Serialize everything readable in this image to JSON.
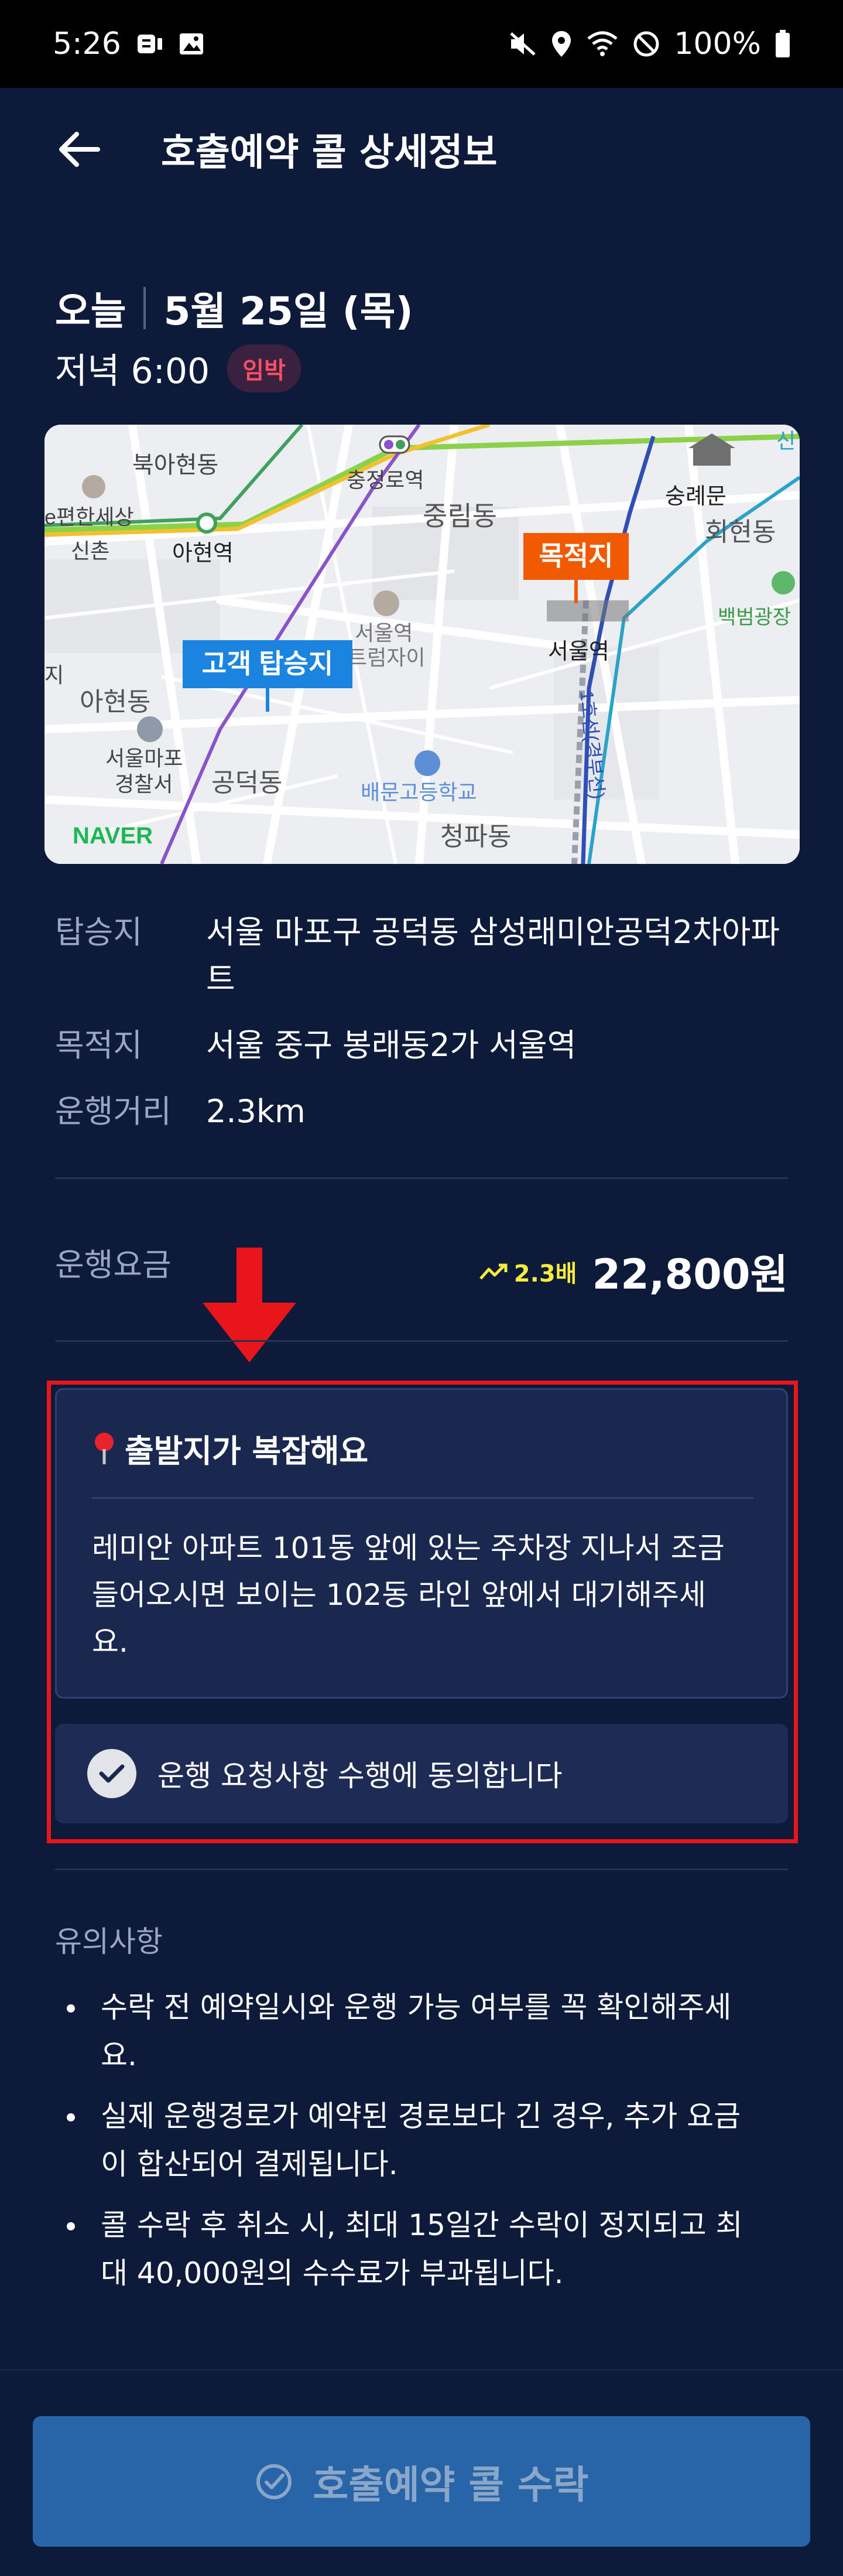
{
  "status_bar": {
    "time": "5:26",
    "battery": "100%"
  },
  "header": {
    "title": "호출예약 콜 상세정보"
  },
  "schedule": {
    "day": "오늘",
    "date": "5월 25일 (목)",
    "time": "저녁 6:00",
    "badge": "임박"
  },
  "map": {
    "labels": {
      "chungjeongno": "충정로역",
      "bukahyeon": "북아현동",
      "pyeonhan": "e편한세상",
      "sinchon": "신촌",
      "ahyeon_station": "아현역",
      "jungnim": "중림동",
      "sungnyemun": "숭례문",
      "hoehyeon": "회현동",
      "baekbeom": "백범광장",
      "seoul_station_tower": "서울역",
      "trade": "트럼자이",
      "ahyeon_dong": "아현동",
      "mapo_police1": "서울마포",
      "mapo_police2": "경찰서",
      "gongdeok": "공덕동",
      "baemun": "배문고등학교",
      "cheongpa": "청파동",
      "seoul_station": "서울역",
      "line1": "1호선(경부선)",
      "ji": "지",
      "sin": "신"
    },
    "pickup_label": "고객 탑승지",
    "destination_label": "목적지",
    "logo": "NAVER"
  },
  "trip": {
    "pickup_label": "탑승지",
    "pickup_line1": "서울 마포구 공덕동 삼성래미안공덕2차아파",
    "pickup_line2": "트",
    "destination_label": "목적지",
    "destination_value": "서울 중구 봉래동2가 서울역",
    "distance_label": "운행거리",
    "distance_value": "2.3km"
  },
  "fare": {
    "label": "운행요금",
    "surge": "2.3배",
    "amount": "22,800원"
  },
  "notice": {
    "title": "출발지가 복잡해요",
    "body_line1": "레미안 아파트 101동 앞에 있는 주차장 지나서 조금",
    "body_line2": "들어오시면 보이는 102동 라인 앞에서 대기해주세",
    "body_line3": "요."
  },
  "agreement": {
    "label": "운행 요청사항 수행에 동의합니다"
  },
  "caution": {
    "title": "유의사항",
    "items": [
      {
        "line1": "수락 전 예약일시와 운행 가능 여부를 꼭 확인해주세",
        "line2": "요."
      },
      {
        "line1": "실제 운행경로가 예약된 경로보다 긴 경우, 추가 요금",
        "line2": "이 합산되어 결제됩니다."
      },
      {
        "line1": "콜 수락 후 취소 시, 최대 15일간 수락이 정지되고 최",
        "line2": "대 40,000원의 수수료가 부과됩니다."
      }
    ]
  },
  "accept_button": {
    "label": "호출예약 콜 수락"
  },
  "colors": {
    "background": "#0d1a3a",
    "accent": "#2764a8",
    "surge": "#f5ec3b",
    "urgent": "#ff4f64",
    "highlight": "#e8151b"
  }
}
